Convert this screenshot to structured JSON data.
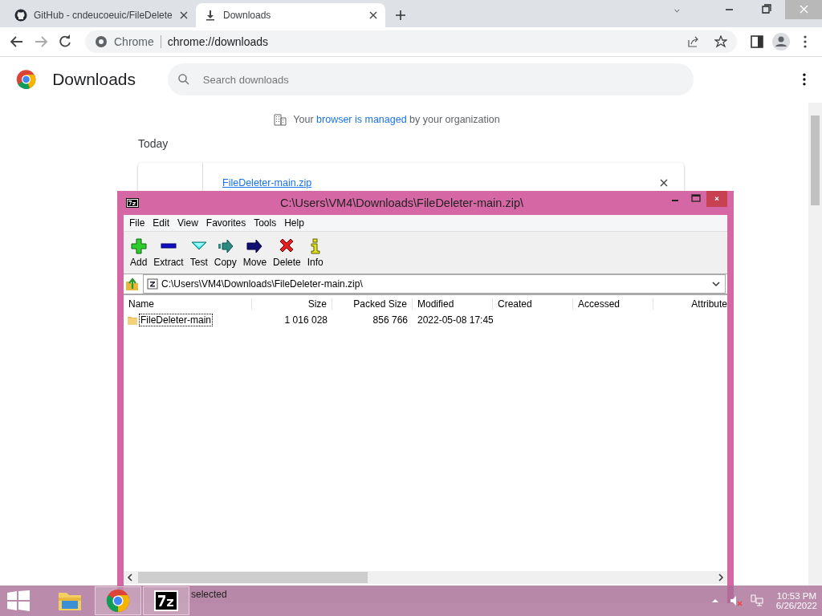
{
  "browser": {
    "tabs": [
      {
        "title": "GitHub - cndeucoeuic/FileDelete",
        "kind": "github",
        "selected": false
      },
      {
        "title": "Downloads",
        "kind": "download",
        "selected": true
      }
    ],
    "omnibox": {
      "chip": "Chrome",
      "url": "chrome://downloads"
    }
  },
  "downloads_page": {
    "title": "Downloads",
    "search": {
      "placeholder": "Search downloads"
    },
    "managed_notice": {
      "before": "Your",
      "link": "browser is managed",
      "after": "by your organization"
    },
    "section": "Today",
    "items": [
      {
        "file_name": "FileDeleter-main.zip"
      }
    ]
  },
  "archive_window": {
    "title": "C:\\Users\\VM4\\Downloads\\FileDeleter-main.zip\\",
    "menu": [
      "File",
      "Edit",
      "View",
      "Favorites",
      "Tools",
      "Help"
    ],
    "toolbar": [
      {
        "label": "Add",
        "kind": "add"
      },
      {
        "label": "Extract",
        "kind": "extract"
      },
      {
        "label": "Test",
        "kind": "test"
      },
      {
        "label": "Copy",
        "kind": "copy"
      },
      {
        "label": "Move",
        "kind": "move"
      },
      {
        "label": "Delete",
        "kind": "delete"
      },
      {
        "label": "Info",
        "kind": "info"
      }
    ],
    "path": "C:\\Users\\VM4\\Downloads\\FileDeleter-main.zip\\",
    "columns": [
      "Name",
      "Size",
      "Packed Size",
      "Modified",
      "Created",
      "Accessed",
      "Attribute"
    ],
    "rows": [
      {
        "kind": "folder",
        "focused": true,
        "cells": [
          "FileDeleter-main",
          "1 016 028",
          "856 766",
          "2022-05-08 17:45"
        ]
      }
    ],
    "status": "selected"
  },
  "taskbar": {
    "apps": [
      {
        "kind": "explorer",
        "running": false
      },
      {
        "kind": "chrome",
        "running": true
      },
      {
        "kind": "sevenzip",
        "running": true
      }
    ],
    "time": "10:53 PM",
    "date": "6/26/2022"
  }
}
